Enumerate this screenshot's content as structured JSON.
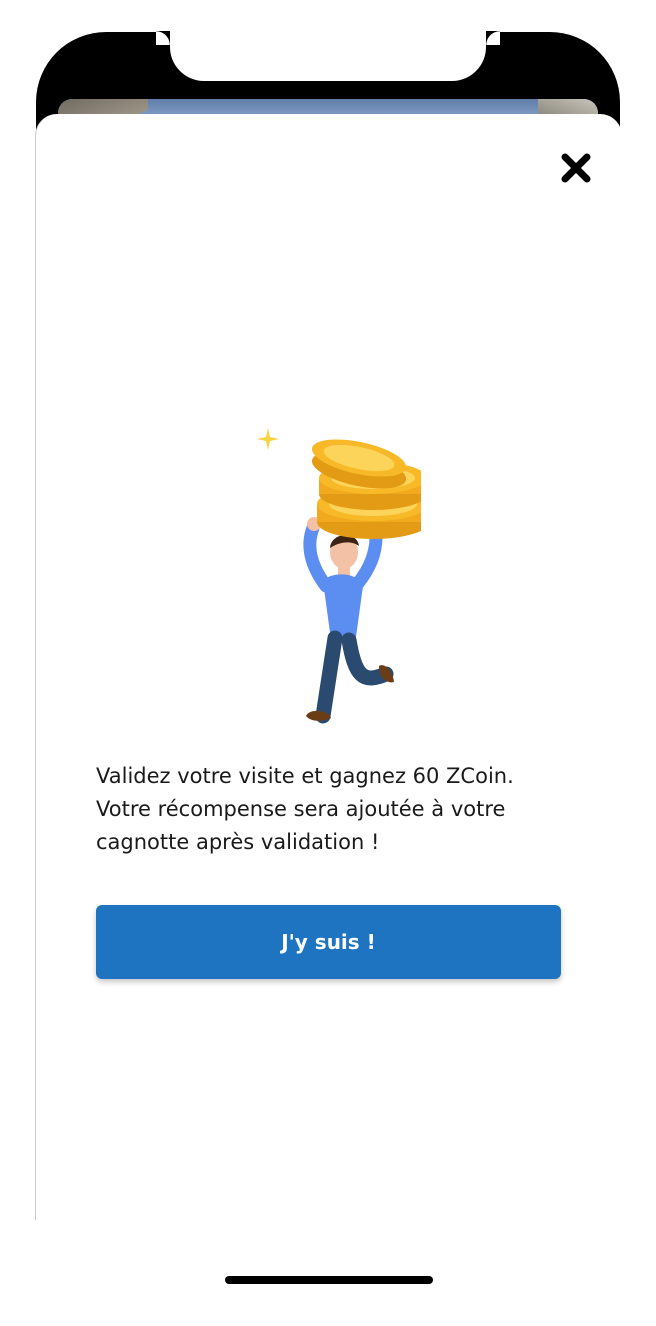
{
  "modal": {
    "message_lines": [
      "Validez votre visite et gagnez 60 ZCoin.",
      "Votre récompense sera ajoutée à votre",
      "cagnotte après validation !"
    ],
    "confirm_label": "J'y suis !",
    "close_icon": "close-icon",
    "illustration": "person-carrying-coins-illustration"
  },
  "colors": {
    "accent": "#1f74c1",
    "coin": "#f7b928",
    "sparkle": "#f9d342",
    "shirt": "#5b8ef0",
    "pants": "#2b4a6f"
  }
}
